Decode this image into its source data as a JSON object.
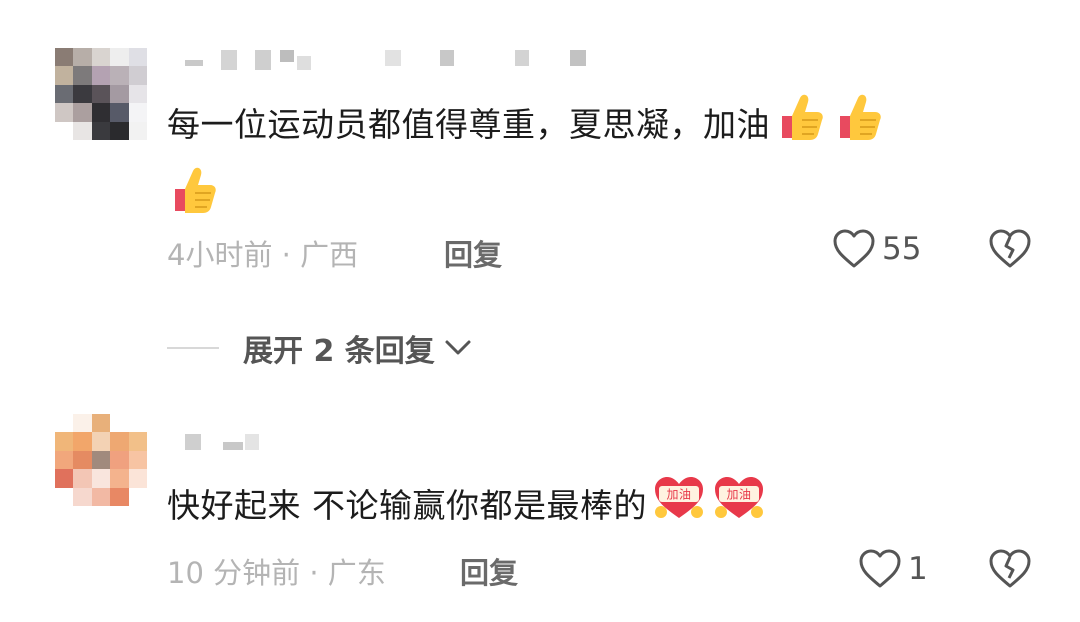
{
  "comments": [
    {
      "text": "每一位运动员都值得尊重，夏思凝，加油",
      "emoji": [
        "thumbs-up-icon",
        "thumbs-up-icon",
        "thumbs-up-icon"
      ],
      "time": "4小时前",
      "separator": "·",
      "location": "广西",
      "reply_label": "回复",
      "likes": "55",
      "expand_label": "展开 2 条回复"
    },
    {
      "text": "快好起来 不论输赢你都是最棒的",
      "emoji_label": "加油",
      "time": "10 分钟前",
      "separator": "·",
      "location": "广东",
      "reply_label": "回复",
      "likes": "1"
    }
  ],
  "colors": {
    "text": "#1c1c1c",
    "meta": "#b4b4b4",
    "icon": "#555555",
    "thumb": "#ffc83d",
    "heart_badge": "#e8394a"
  }
}
